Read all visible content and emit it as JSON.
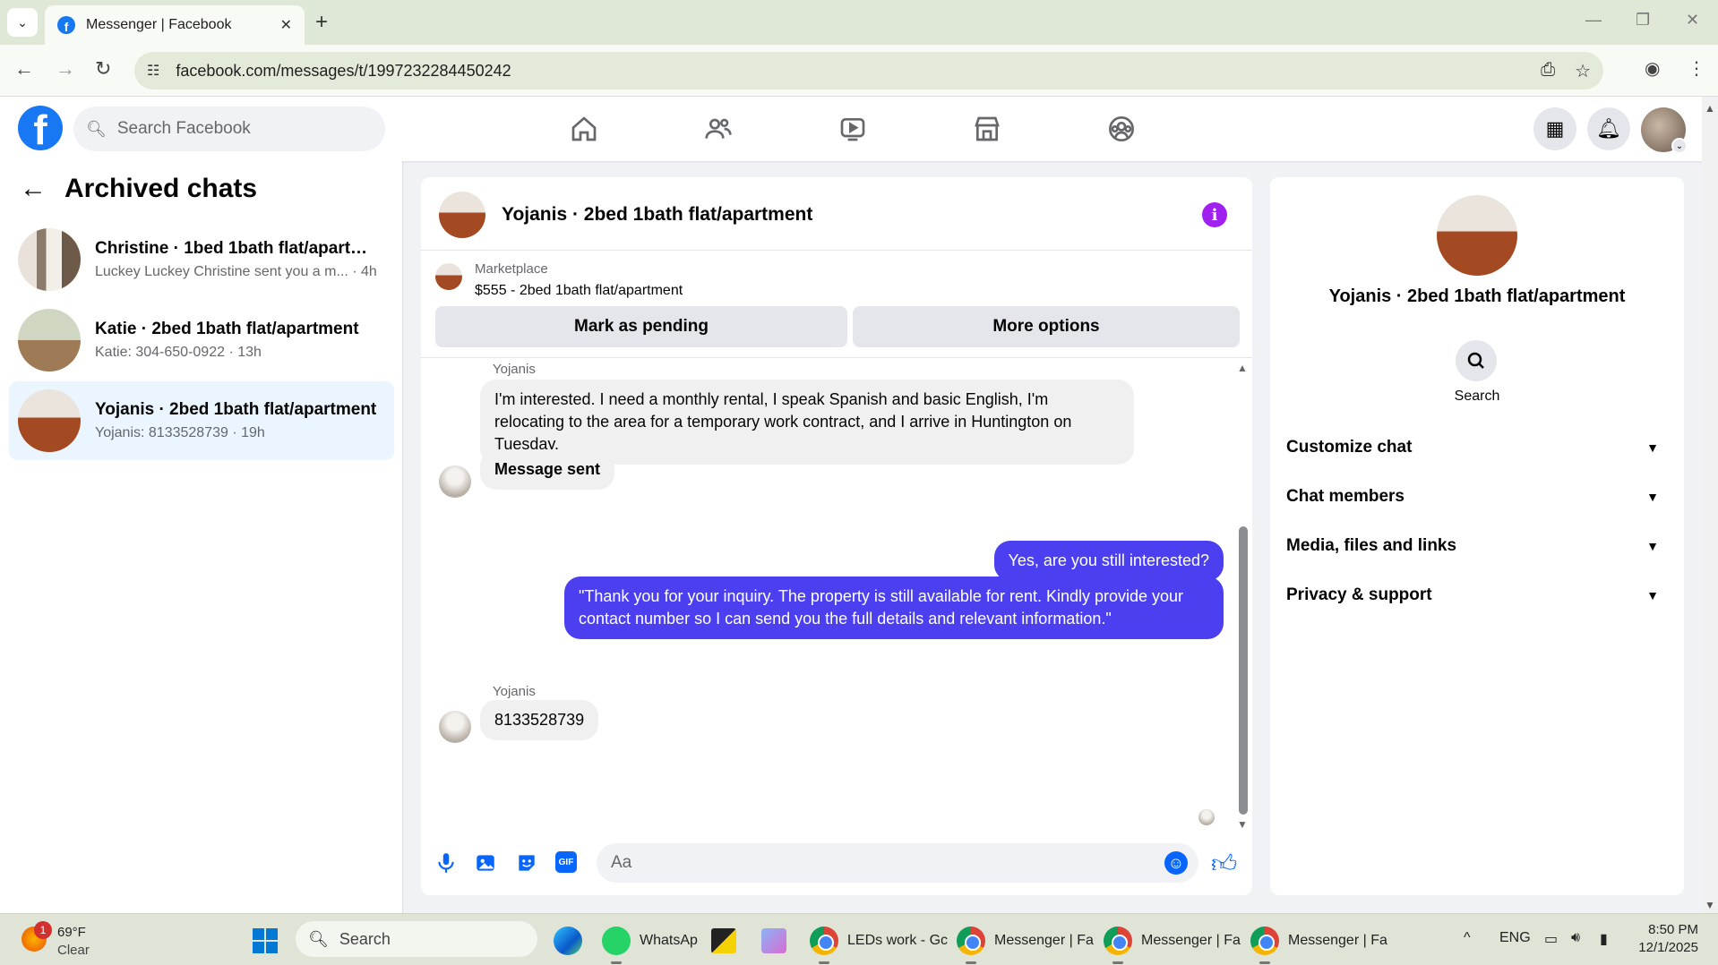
{
  "browser": {
    "tab_title": "Messenger | Facebook",
    "url": "facebook.com/messages/t/1997232284450242"
  },
  "fb": {
    "search_placeholder": "Search Facebook"
  },
  "left": {
    "title": "Archived chats",
    "chats": [
      {
        "name": "Christine · 1bed 1bath flat/apartme...",
        "snippet": "Luckey Luckey Christine sent you a m...",
        "time": "· 4h"
      },
      {
        "name": "Katie · 2bed 1bath flat/apartment",
        "snippet": "Katie: 304-650-0922",
        "time": "· 13h"
      },
      {
        "name": "Yojanis · 2bed 1bath flat/apartment",
        "snippet": "Yojanis: 8133528739",
        "time": "· 19h"
      }
    ]
  },
  "chat": {
    "title": "Yojanis · 2bed 1bath flat/apartment",
    "marketplace_label": "Marketplace",
    "listing": "$555 - 2bed 1bath flat/apartment",
    "btn_pending": "Mark as pending",
    "btn_more": "More options",
    "messages": {
      "sender1": "Yojanis",
      "in1": "I'm interested. I need a monthly rental, I speak Spanish and basic English, I'm relocating to the area for a temporary work contract, and I arrive in Huntington on Tuesday.",
      "in2": "Message sent",
      "out1": "Yes, are you still interested?",
      "out2": "\"Thank you for your inquiry. The property is still available for rent. Kindly provide your contact number so I can send you the full details and relevant information.\"",
      "sender2": "Yojanis",
      "in3": "8133528739"
    },
    "composer_placeholder": "Aa",
    "gif_label": "GIF"
  },
  "right": {
    "name": "Yojanis · 2bed 1bath flat/apartment",
    "search_label": "Search",
    "sections": [
      "Customize chat",
      "Chat members",
      "Media, files and links",
      "Privacy & support"
    ]
  },
  "taskbar": {
    "temp": "69°F",
    "condition": "Clear",
    "weather_badge": "1",
    "search_placeholder": "Search",
    "apps": [
      {
        "label": "WhatsAp"
      },
      {
        "label": "LEDs work - Gc"
      },
      {
        "label": "Messenger | Fa"
      },
      {
        "label": "Messenger | Fa"
      },
      {
        "label": "Messenger | Fa"
      }
    ],
    "lang": "ENG",
    "time": "8:50 PM",
    "date": "12/1/2025"
  },
  "colors": {
    "fb_blue": "#1877f2",
    "outgoing_bubble": "#4b3ff0",
    "active_chat": "#ebf5ff",
    "info_purple": "#a020f0"
  }
}
